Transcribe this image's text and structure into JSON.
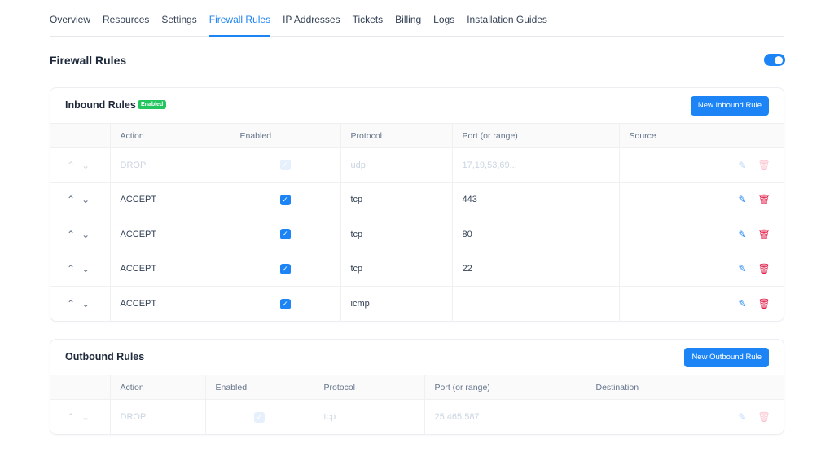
{
  "nav": {
    "tabs": [
      "Overview",
      "Resources",
      "Settings",
      "Firewall Rules",
      "IP Addresses",
      "Tickets",
      "Billing",
      "Logs",
      "Installation Guides"
    ],
    "active": "Firewall Rules"
  },
  "page_title": "Firewall Rules",
  "firewall_enabled": true,
  "inbound": {
    "title": "Inbound Rules",
    "badge": "Enabled",
    "button": "New Inbound Rule",
    "columns": [
      "Action",
      "Enabled",
      "Protocol",
      "Port (or range)",
      "Source"
    ],
    "rows": [
      {
        "action": "DROP",
        "enabled": true,
        "protocol": "udp",
        "port": "17,19,53,69...",
        "source": "",
        "dim": true
      },
      {
        "action": "ACCEPT",
        "enabled": true,
        "protocol": "tcp",
        "port": "443",
        "source": ""
      },
      {
        "action": "ACCEPT",
        "enabled": true,
        "protocol": "tcp",
        "port": "80",
        "source": ""
      },
      {
        "action": "ACCEPT",
        "enabled": true,
        "protocol": "tcp",
        "port": "22",
        "source": ""
      },
      {
        "action": "ACCEPT",
        "enabled": true,
        "protocol": "icmp",
        "port": "",
        "source": ""
      }
    ]
  },
  "outbound": {
    "title": "Outbound Rules",
    "button": "New Outbound Rule",
    "columns": [
      "Action",
      "Enabled",
      "Protocol",
      "Port (or range)",
      "Destination"
    ],
    "rows": [
      {
        "action": "DROP",
        "enabled": true,
        "protocol": "tcp",
        "port": "25,465,587",
        "destination": "",
        "dim": true
      }
    ]
  }
}
